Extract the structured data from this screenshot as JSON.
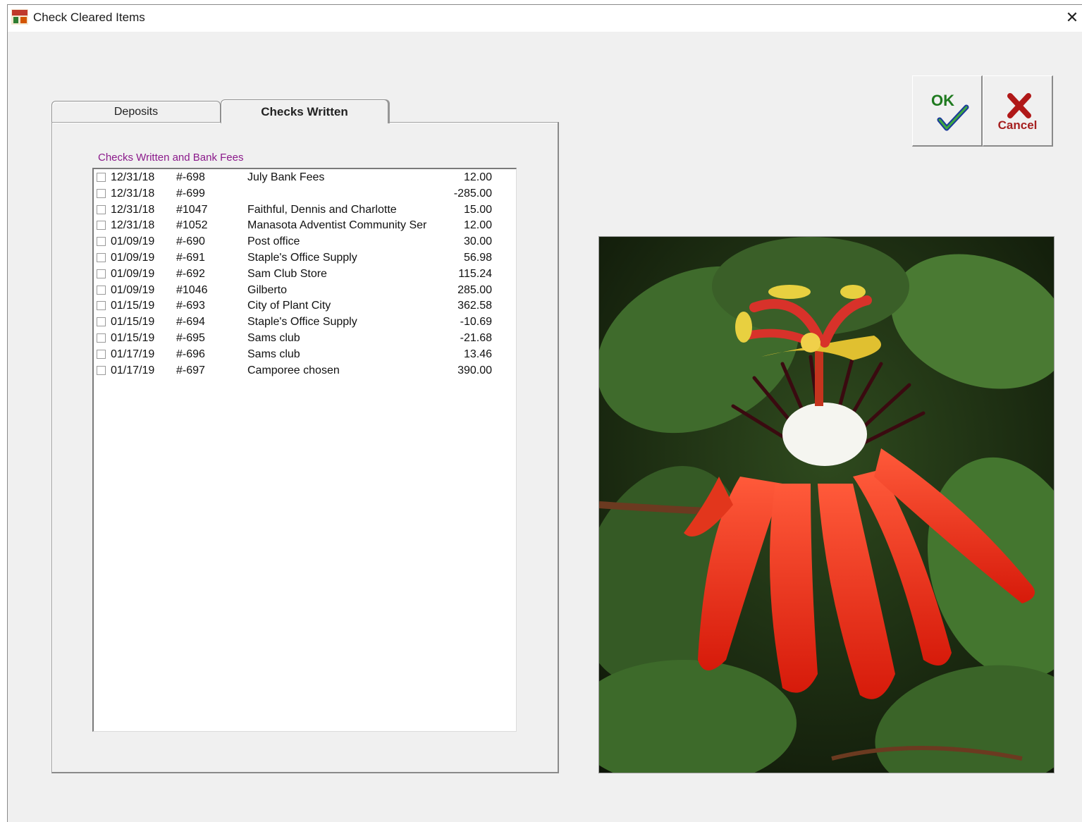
{
  "window": {
    "title": "Check Cleared Items",
    "close_glyph": "✕"
  },
  "tabs": [
    {
      "label": "Deposits",
      "active": false
    },
    {
      "label": "Checks Written",
      "active": true
    }
  ],
  "list": {
    "caption": "Checks Written and Bank Fees",
    "rows": [
      {
        "date": "12/31/18",
        "number": "#-698",
        "payee": "July Bank Fees",
        "amount": "12.00",
        "checked": false
      },
      {
        "date": "12/31/18",
        "number": "#-699",
        "payee": "",
        "amount": "-285.00",
        "checked": false
      },
      {
        "date": "12/31/18",
        "number": "#1047",
        "payee": "Faithful, Dennis and Charlotte",
        "amount": "15.00",
        "checked": false
      },
      {
        "date": "12/31/18",
        "number": "#1052",
        "payee": "Manasota Adventist Community Ser",
        "amount": "12.00",
        "checked": false
      },
      {
        "date": "01/09/19",
        "number": "#-690",
        "payee": "Post office",
        "amount": "30.00",
        "checked": false
      },
      {
        "date": "01/09/19",
        "number": "#-691",
        "payee": "Staple's Office Supply",
        "amount": "56.98",
        "checked": false
      },
      {
        "date": "01/09/19",
        "number": "#-692",
        "payee": "Sam Club Store",
        "amount": "115.24",
        "checked": false
      },
      {
        "date": "01/09/19",
        "number": "#1046",
        "payee": "Gilberto",
        "amount": "285.00",
        "checked": false
      },
      {
        "date": "01/15/19",
        "number": "#-693",
        "payee": "City of Plant City",
        "amount": "362.58",
        "checked": false
      },
      {
        "date": "01/15/19",
        "number": "#-694",
        "payee": "Staple's Office Supply",
        "amount": "-10.69",
        "checked": false
      },
      {
        "date": "01/15/19",
        "number": "#-695",
        "payee": "Sams club",
        "amount": "-21.68",
        "checked": false
      },
      {
        "date": "01/17/19",
        "number": "#-696",
        "payee": "Sams club",
        "amount": "13.46",
        "checked": false
      },
      {
        "date": "01/17/19",
        "number": "#-697",
        "payee": "Camporee chosen",
        "amount": "390.00",
        "checked": false
      }
    ]
  },
  "buttons": {
    "ok_label": "OK",
    "cancel_label": "Cancel"
  },
  "colors": {
    "caption": "#8b1a8b",
    "ok_green": "#1f7a1f",
    "check_blue": "#1a3a9a",
    "cancel_red": "#a62020"
  },
  "photo": {
    "subject": "red passion flower",
    "icon": "flower-photo"
  }
}
